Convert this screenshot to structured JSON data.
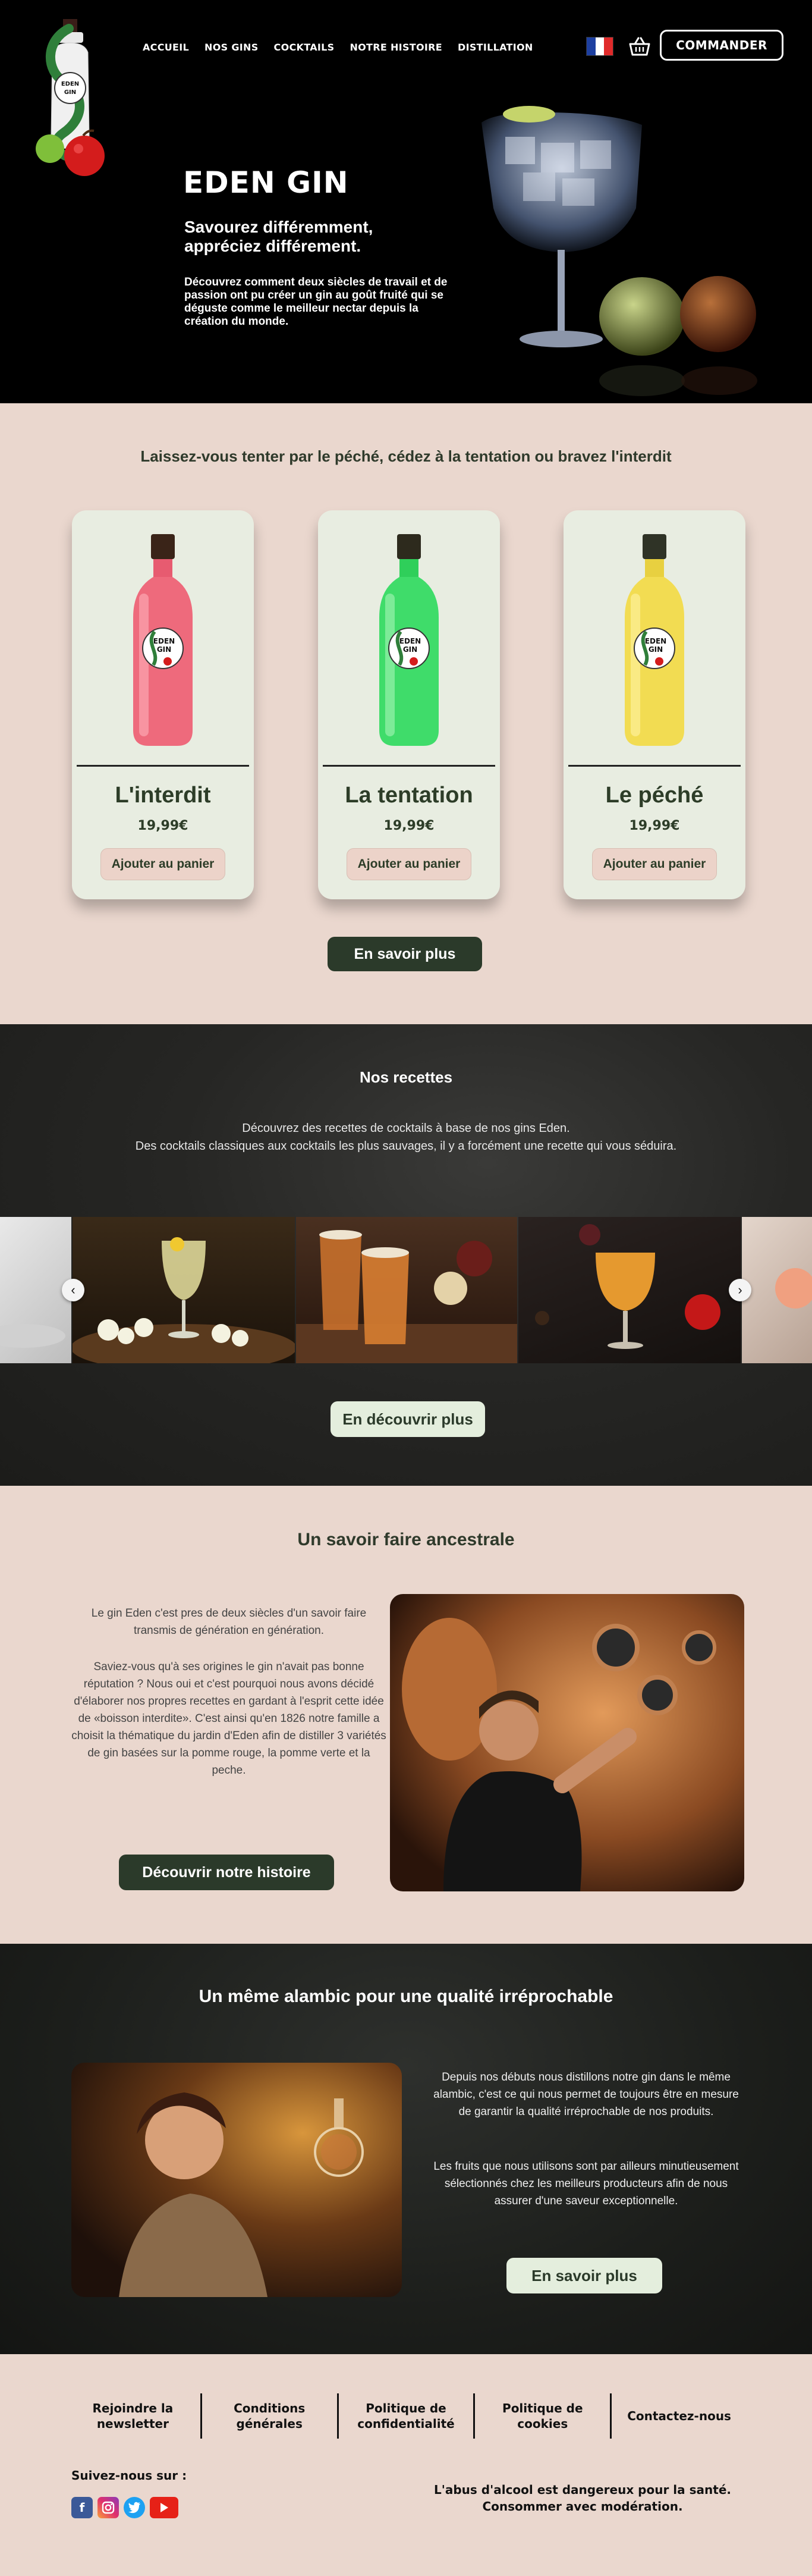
{
  "nav": {
    "items": [
      "ACCUEIL",
      "NOS GINS",
      "COCKTAILS",
      "NOTRE HISTOIRE",
      "DISTILLATION"
    ],
    "order_label": "COMMANDER",
    "flag_icon": "france-flag-icon",
    "cart_icon": "basket-icon"
  },
  "logo": {
    "text_top": "EDEN",
    "text_bottom": "GIN"
  },
  "hero": {
    "title": "EDEN GIN",
    "subtitle": "Savourez différemment, appréciez différement.",
    "description": "Découvrez comment deux siècles de travail et de passion ont pu créer un gin au goût fruité qui se déguste comme le meilleur nectar depuis la création du monde."
  },
  "gins": {
    "heading": "Laissez-vous tenter par le péché, cédez à la tentation ou bravez l'interdit",
    "products": [
      {
        "name": "L'interdit",
        "price": "19,99€",
        "button": "Ajouter au panier",
        "color": "#ee6a7c"
      },
      {
        "name": "La tentation",
        "price": "19,99€",
        "button": "Ajouter au panier",
        "color": "#3fdc6a"
      },
      {
        "name": "Le péché",
        "price": "19,99€",
        "button": "Ajouter au panier",
        "color": "#f2dc52"
      }
    ],
    "bottle_label": "EDEN GIN",
    "more_label": "En savoir plus"
  },
  "recipes": {
    "heading": "Nos recettes",
    "line1": "Découvrez des recettes de cocktails à base de nos gins Eden.",
    "line2": "Des cocktails classiques aux cocktails les plus sauvages, il y a forcément une recette qui vous séduira.",
    "prev_icon": "arrow-left-icon",
    "next_icon": "arrow-right-icon",
    "more_label": "En découvrir plus"
  },
  "savoir": {
    "heading": "Un savoir faire ancestrale",
    "p1": "Le gin Eden c'est pres de deux siècles d'un savoir faire transmis de génération en génération.",
    "p2": "Saviez-vous qu'à ses origines le gin n'avait pas bonne réputation ? Nous oui et c'est pourquoi nous avons décidé d'élaborer nos propres recettes en gardant à l'esprit cette idée de «boisson interdite». C'est ainsi qu'en 1826 notre famille a choisit la thématique du jardin d'Eden afin de distiller 3 variétés de gin basées sur la pomme rouge, la pomme verte et la peche.",
    "button": "Découvrir notre histoire"
  },
  "alambic": {
    "heading": "Un même alambic pour une qualité irréprochable",
    "p1": "Depuis nos débuts nous distillons notre gin dans le même alambic, c'est ce qui nous permet de toujours être en mesure de garantir la qualité irréprochable de nos produits.",
    "p2": "Les fruits que nous utilisons sont par ailleurs minutieusement sélectionnés chez les meilleurs producteurs afin de nous assurer d'une saveur exceptionnelle.",
    "button": "En savoir plus"
  },
  "footer": {
    "links": [
      "Rejoindre la newsletter",
      "Conditions générales",
      "Politique de confidentialité",
      "Politique de cookies",
      "Contactez-nous"
    ],
    "follow": "Suivez-nous sur :",
    "socials": [
      "facebook-icon",
      "instagram-icon",
      "twitter-icon",
      "youtube-icon"
    ],
    "warning_line1": "L'abus d'alcool est dangereux pour la santé.",
    "warning_line2": "Consommer avec modération."
  }
}
